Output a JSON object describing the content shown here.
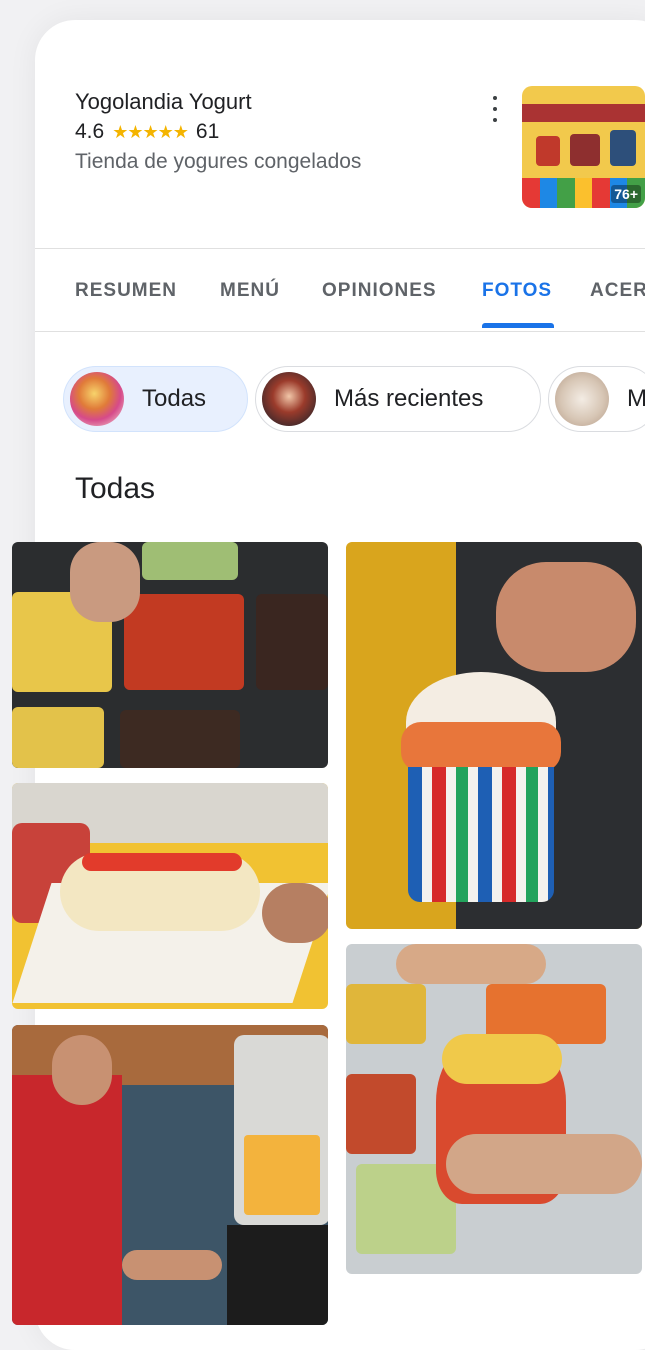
{
  "place": {
    "name": "Yogolandia Yogurt",
    "rating": "4.6",
    "stars": "★★★★★",
    "reviews": "61",
    "category": "Tienda de yogures congelados",
    "photo_count": "76+"
  },
  "tabs": [
    {
      "label": "RESUMEN",
      "active": false
    },
    {
      "label": "MENÚ",
      "active": false
    },
    {
      "label": "OPINIONES",
      "active": false
    },
    {
      "label": "FOTOS",
      "active": true
    },
    {
      "label": "ACER",
      "active": false
    }
  ],
  "chips": [
    {
      "label": "Todas",
      "active": true
    },
    {
      "label": "Más recientes",
      "active": false
    },
    {
      "label": "M",
      "active": false
    }
  ],
  "section_title": "Todas",
  "colors": {
    "accent": "#1a73e8",
    "star": "#f4b400",
    "chip_active": "#e8f0fe"
  }
}
